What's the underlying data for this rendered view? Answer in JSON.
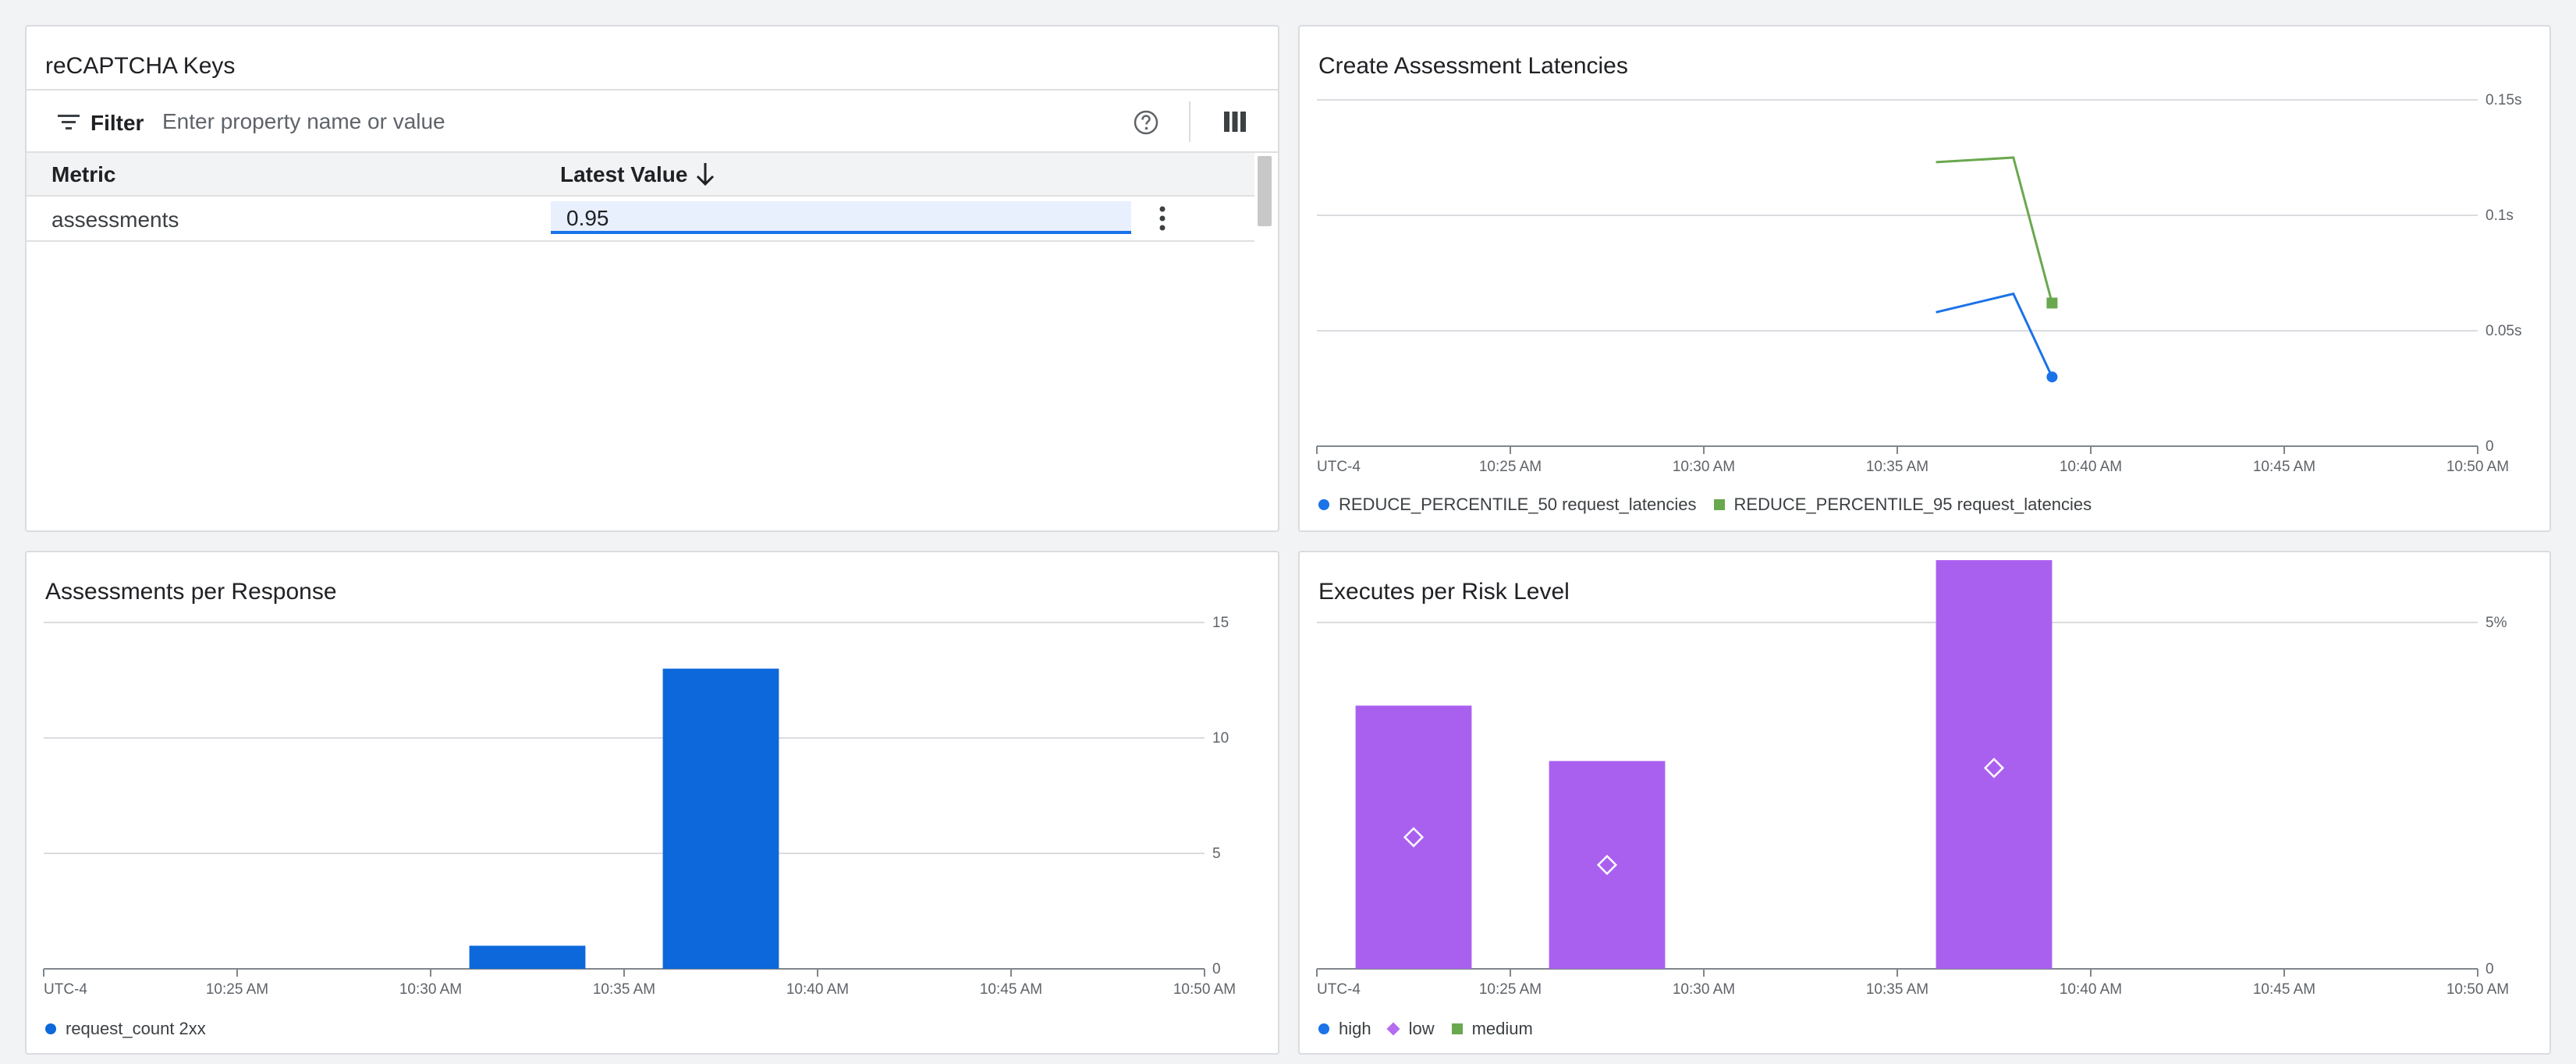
{
  "table_card": {
    "title": "reCAPTCHA Keys",
    "filter_label": "Filter",
    "filter_placeholder": "Enter property name or value",
    "columns": [
      "Metric",
      "Latest Value"
    ],
    "rows": [
      {
        "metric": "assessments",
        "value": "0.95"
      }
    ],
    "icons": [
      "filter-icon",
      "help-icon",
      "columns-icon",
      "arrow-down-icon",
      "more-vert-icon"
    ]
  },
  "latency_card": {
    "title": "Create Assessment Latencies"
  },
  "assess_card": {
    "title": "Assessments per Response"
  },
  "risk_card": {
    "title": "Executes per Risk Level"
  },
  "chart_data": [
    {
      "id": "latency",
      "type": "line",
      "title": "Create Assessment Latencies",
      "x_ticks": [
        "UTC-4",
        "10:25 AM",
        "10:30 AM",
        "10:35 AM",
        "10:40 AM",
        "10:45 AM",
        "10:50 AM"
      ],
      "x_range": [
        "10:20 AM",
        "10:50 AM"
      ],
      "y_ticks": [
        "0",
        "0.05s",
        "0.1s",
        "0.15s"
      ],
      "ylim": [
        0,
        0.15
      ],
      "grid": true,
      "legend_position": "bottom-left",
      "series": [
        {
          "name": "REDUCE_PERCENTILE_50 request_latencies",
          "color": "#1a73e8",
          "marker": "circle",
          "x": [
            "10:36 AM",
            "10:38 AM",
            "10:39 AM"
          ],
          "values": [
            0.058,
            0.066,
            0.03
          ]
        },
        {
          "name": "REDUCE_PERCENTILE_95 request_latencies",
          "color": "#6aa84f",
          "marker": "square",
          "x": [
            "10:36 AM",
            "10:38 AM",
            "10:39 AM"
          ],
          "values": [
            0.123,
            0.125,
            0.062
          ]
        }
      ]
    },
    {
      "id": "assess",
      "type": "bar",
      "title": "Assessments per Response",
      "x_ticks": [
        "UTC-4",
        "10:25 AM",
        "10:30 AM",
        "10:35 AM",
        "10:40 AM",
        "10:45 AM",
        "10:50 AM"
      ],
      "x_range": [
        "10:20 AM",
        "10:50 AM"
      ],
      "y_ticks": [
        "0",
        "5",
        "10",
        "15"
      ],
      "ylim": [
        0,
        15
      ],
      "grid": true,
      "legend_position": "bottom-left",
      "series": [
        {
          "name": "request_count 2xx",
          "color": "#0c68db",
          "bars": [
            {
              "start": "10:31 AM",
              "end": "10:34 AM",
              "value": 1
            },
            {
              "start": "10:36 AM",
              "end": "10:39 AM",
              "value": 13
            }
          ]
        }
      ]
    },
    {
      "id": "risk",
      "type": "bar",
      "title": "Executes per Risk Level",
      "x_ticks": [
        "UTC-4",
        "10:25 AM",
        "10:30 AM",
        "10:35 AM",
        "10:40 AM",
        "10:45 AM",
        "10:50 AM"
      ],
      "x_range": [
        "10:20 AM",
        "10:50 AM"
      ],
      "y_ticks": [
        "0",
        "5%"
      ],
      "ylim": [
        0,
        5
      ],
      "grid": true,
      "legend_position": "bottom-left",
      "legend": [
        {
          "name": "high",
          "color": "#1a73e8",
          "marker": "circle"
        },
        {
          "name": "low",
          "color": "#b36bf0",
          "marker": "diamond"
        },
        {
          "name": "medium",
          "color": "#6aa84f",
          "marker": "square"
        }
      ],
      "series": [
        {
          "name": "low",
          "color": "#aa60ef",
          "bars": [
            {
              "start": "10:21 AM",
              "end": "10:24 AM",
              "value": 3.8,
              "marker_value": 1.9
            },
            {
              "start": "10:26 AM",
              "end": "10:29 AM",
              "value": 3.0,
              "marker_value": 1.5
            },
            {
              "start": "10:36 AM",
              "end": "10:39 AM",
              "value": 5.9,
              "marker_value": 2.9
            }
          ]
        }
      ]
    }
  ]
}
